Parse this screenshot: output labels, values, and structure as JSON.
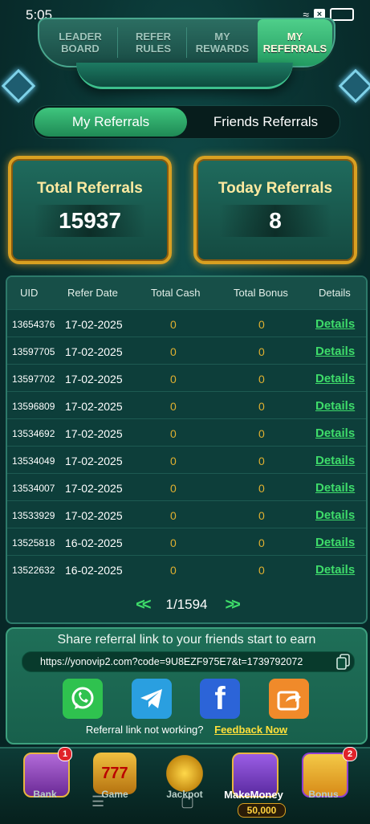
{
  "status_bar": {
    "time": "5:05"
  },
  "top_tabs": [
    {
      "line1": "LEADER",
      "line2": "BOARD"
    },
    {
      "line1": "REFER",
      "line2": "RULES"
    },
    {
      "line1": "MY",
      "line2": "REWARDS"
    },
    {
      "line1": "MY",
      "line2": "REFERRALS"
    }
  ],
  "switch": {
    "active": "My Referrals",
    "inactive": "Friends Referrals"
  },
  "stats": {
    "total_label": "Total Referrals",
    "total_value": "15937",
    "today_label": "Today Referrals",
    "today_value": "8"
  },
  "table": {
    "headers": [
      "UID",
      "Refer Date",
      "Total Cash",
      "Total Bonus",
      "Details"
    ],
    "rows": [
      {
        "uid": "13654376",
        "date": "17-02-2025",
        "cash": "0",
        "bonus": "0",
        "details": "Details"
      },
      {
        "uid": "13597705",
        "date": "17-02-2025",
        "cash": "0",
        "bonus": "0",
        "details": "Details"
      },
      {
        "uid": "13597702",
        "date": "17-02-2025",
        "cash": "0",
        "bonus": "0",
        "details": "Details"
      },
      {
        "uid": "13596809",
        "date": "17-02-2025",
        "cash": "0",
        "bonus": "0",
        "details": "Details"
      },
      {
        "uid": "13534692",
        "date": "17-02-2025",
        "cash": "0",
        "bonus": "0",
        "details": "Details"
      },
      {
        "uid": "13534049",
        "date": "17-02-2025",
        "cash": "0",
        "bonus": "0",
        "details": "Details"
      },
      {
        "uid": "13534007",
        "date": "17-02-2025",
        "cash": "0",
        "bonus": "0",
        "details": "Details"
      },
      {
        "uid": "13533929",
        "date": "17-02-2025",
        "cash": "0",
        "bonus": "0",
        "details": "Details"
      },
      {
        "uid": "13525818",
        "date": "16-02-2025",
        "cash": "0",
        "bonus": "0",
        "details": "Details"
      },
      {
        "uid": "13522632",
        "date": "16-02-2025",
        "cash": "0",
        "bonus": "0",
        "details": "Details"
      }
    ]
  },
  "pager": {
    "prev": "<<",
    "page": "1/1594",
    "next": ">>"
  },
  "share": {
    "title": "Share referral link to your friends start to earn",
    "link": "https://yonovip2.com?code=9U8EZF975E7&t=1739792072",
    "not_working": "Referral link not working?",
    "feedback": "Feedback Now",
    "icons": [
      "whatsapp-icon",
      "telegram-icon",
      "facebook-icon",
      "share-icon"
    ]
  },
  "bottom_nav": [
    {
      "label": "Bank",
      "badge": "1"
    },
    {
      "label": "Game",
      "badge": ""
    },
    {
      "label": "Jackpot",
      "badge": ""
    },
    {
      "label": "MakeMoney",
      "badge": ""
    },
    {
      "label": "Bonus",
      "badge": "2"
    }
  ],
  "coins": "50,000",
  "colors": {
    "accent": "#3edc6a",
    "gold": "#d9a021",
    "zero": "#e0b030"
  }
}
